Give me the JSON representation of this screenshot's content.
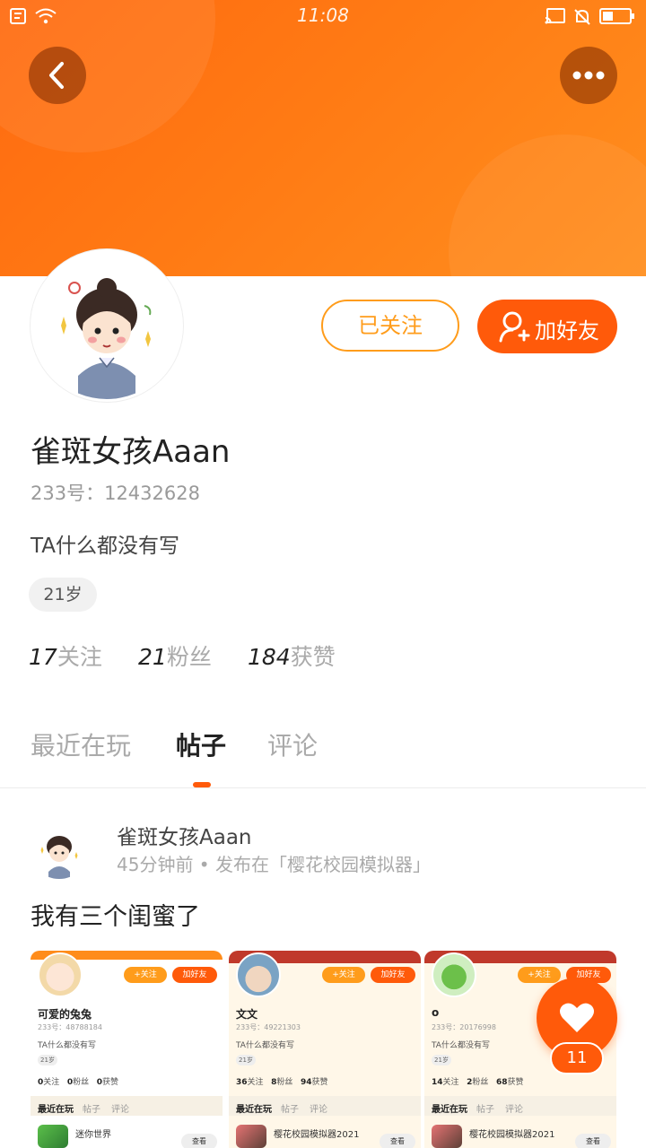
{
  "status_bar": {
    "time": "11:08"
  },
  "profile": {
    "username": "雀斑女孩Aaan",
    "uid_label": "233号：12432628",
    "bio": "TA什么都没有写",
    "age": "21岁",
    "follow_button": "已关注",
    "add_friend_button": "加好友",
    "stats": [
      {
        "num": "17",
        "label": "关注"
      },
      {
        "num": "21",
        "label": "粉丝"
      },
      {
        "num": "184",
        "label": "获赞"
      }
    ]
  },
  "tabs": [
    {
      "label": "最近在玩"
    },
    {
      "label": "帖子"
    },
    {
      "label": "评论"
    }
  ],
  "active_tab": "帖子",
  "post": {
    "author": "雀斑女孩Aaan",
    "meta": "45分钟前 • 发布在「樱花校园模拟器」",
    "text": "我有三个闺蜜了",
    "images": [
      {
        "follow": "+关注",
        "add": "加好友",
        "name": "可爱的兔兔",
        "id": "233号：48788184",
        "bio": "TA什么都没有写",
        "age": "21岁",
        "follows": "0",
        "fans": "0",
        "likes": "0",
        "tabs": [
          "最近在玩",
          "帖子",
          "评论"
        ],
        "game": "迷你世界",
        "game_btn": "查看"
      },
      {
        "follow": "+关注",
        "add": "加好友",
        "name": "文文",
        "id": "233号：49221303",
        "bio": "TA什么都没有写",
        "age": "21岁",
        "follows": "36",
        "fans": "8",
        "likes": "94",
        "tabs": [
          "最近在玩",
          "帖子",
          "评论"
        ],
        "game": "樱花校园模拟器2021",
        "game_btn": "查看"
      },
      {
        "follow": "+关注",
        "add": "加好友",
        "name": "o",
        "id": "233号：20176998",
        "bio": "TA什么都没有写",
        "age": "21岁",
        "follows": "14",
        "fans": "2",
        "likes": "68",
        "tabs": [
          "最近在玩",
          "帖子",
          "评论"
        ],
        "game": "樱花校园模拟器2021",
        "game_btn": "查看"
      }
    ]
  },
  "stat_labels": {
    "follows": "关注",
    "fans": "粉丝",
    "likes": "获赞"
  },
  "fab": {
    "count": "11"
  },
  "colors": {
    "accent": "#ff5a0a",
    "accent_light": "#ff9c1b",
    "header_gradient_start": "#ff6a10",
    "header_gradient_end": "#ff8f1e"
  },
  "icons": {
    "back": "chevron-left-icon",
    "more": "more-dots-icon",
    "add_friend": "add-user-icon",
    "like": "heart-icon",
    "cast": "cast-icon",
    "wifi": "wifi-icon",
    "battery": "battery-icon"
  }
}
